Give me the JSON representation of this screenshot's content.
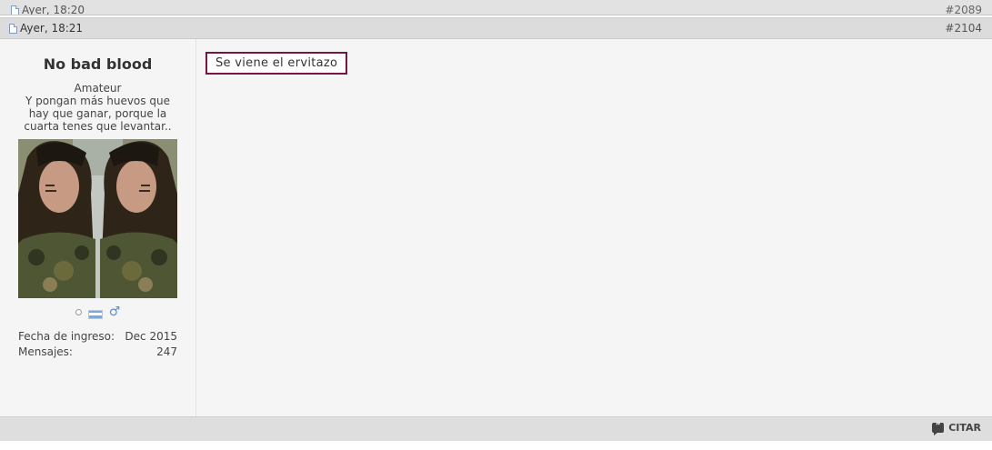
{
  "previous_post": {
    "date": "Ayer, 18:20",
    "number": "#2089"
  },
  "post": {
    "date": "Ayer, 18:21",
    "number": "#2104",
    "message": "Se viene el ervitazo",
    "quote_label": "CITAR"
  },
  "user": {
    "name": "No bad blood",
    "rank": "Amateur",
    "title": "Y pongan más huevos que hay que ganar, porque la cuarta tenes que levantar..",
    "stats": [
      {
        "label": "Fecha de ingreso:",
        "value": "Dec 2015"
      },
      {
        "label": "Mensajes:",
        "value": "247"
      }
    ]
  },
  "icons": {
    "post_date": "document-icon",
    "status": "offline-status-icon",
    "flag": "argentina-flag-icon",
    "gender": "male-gender-icon",
    "quote": "quote-icon"
  },
  "colors": {
    "message_border": "#7a1440",
    "flag_blue": "#74acdf",
    "gender_icon": "#5b8fc9"
  }
}
